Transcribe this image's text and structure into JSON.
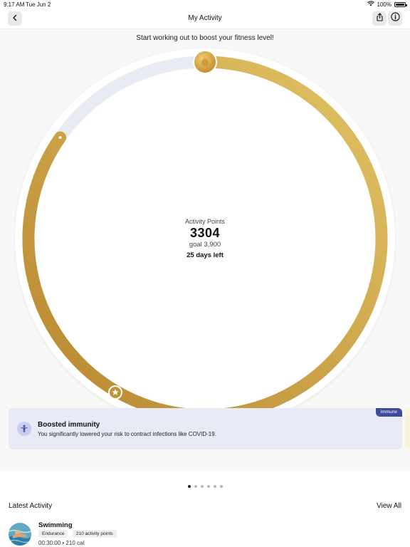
{
  "status_bar": {
    "time": "9:17 AM",
    "date": "Tue Jun 2",
    "battery": "100%"
  },
  "nav": {
    "title": "My Activity",
    "icons": {
      "back": "chevron-left-icon",
      "share": "share-icon",
      "info": "info-icon"
    }
  },
  "motto": "Start working out to boost your fitness level!",
  "ring": {
    "label": "Activity Points",
    "value": "3304",
    "goal_text": "goal 3,900",
    "days_left": "25 days left",
    "progress": 0.847,
    "colors": {
      "track": "#e9ebf2",
      "progress_start": "#b8862f",
      "progress_end": "#e2c466"
    }
  },
  "insight_card": {
    "tag": "immune",
    "title": "Boosted immunity",
    "subtitle": "You significantly lowered your risk to contract infections like COVID-19.",
    "icon": "person-icon",
    "colors": {
      "background": "#e8eaf6",
      "tag": "#3e4a9a"
    }
  },
  "pagination": {
    "count": 6,
    "active_index": 0
  },
  "latest": {
    "title": "Latest Activity",
    "view_all": "View All"
  },
  "activity": {
    "name": "Swimming",
    "tags": [
      "Endurance",
      "210 activity points"
    ],
    "duration": "00:30:00",
    "separator": "•",
    "calories": "210 cal"
  }
}
